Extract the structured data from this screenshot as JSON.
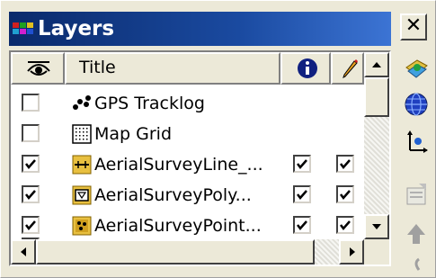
{
  "window": {
    "title": "Layers",
    "close_label": "✕"
  },
  "columns": {
    "title": "Title",
    "info_icon": "info-icon",
    "edit_icon": "pencil-icon",
    "visibility_icon": "eye-icon"
  },
  "layers": [
    {
      "name": "GPS Tracklog",
      "visible": false,
      "info": null,
      "edit": null,
      "icon": "gps-tracklog-icon"
    },
    {
      "name": "Map Grid",
      "visible": false,
      "info": null,
      "edit": null,
      "icon": "map-grid-icon"
    },
    {
      "name": "AerialSurveyLine_...",
      "visible": true,
      "info": true,
      "edit": true,
      "icon": "line-layer-icon"
    },
    {
      "name": "AerialSurveyPoly...",
      "visible": true,
      "info": true,
      "edit": true,
      "icon": "polygon-layer-icon"
    },
    {
      "name": "AerialSurveyPoint...",
      "visible": true,
      "info": true,
      "edit": true,
      "icon": "point-layer-icon"
    }
  ],
  "colors": {
    "title_bar": "#0a2a6b",
    "window_bg": "#ece9d8",
    "panel_bg": "#ffffff"
  },
  "toolbar": [
    "add-layer-icon",
    "globe-icon",
    "coordinate-axes-icon",
    "layer-properties-icon",
    "move-up-icon",
    "move-down-icon"
  ]
}
